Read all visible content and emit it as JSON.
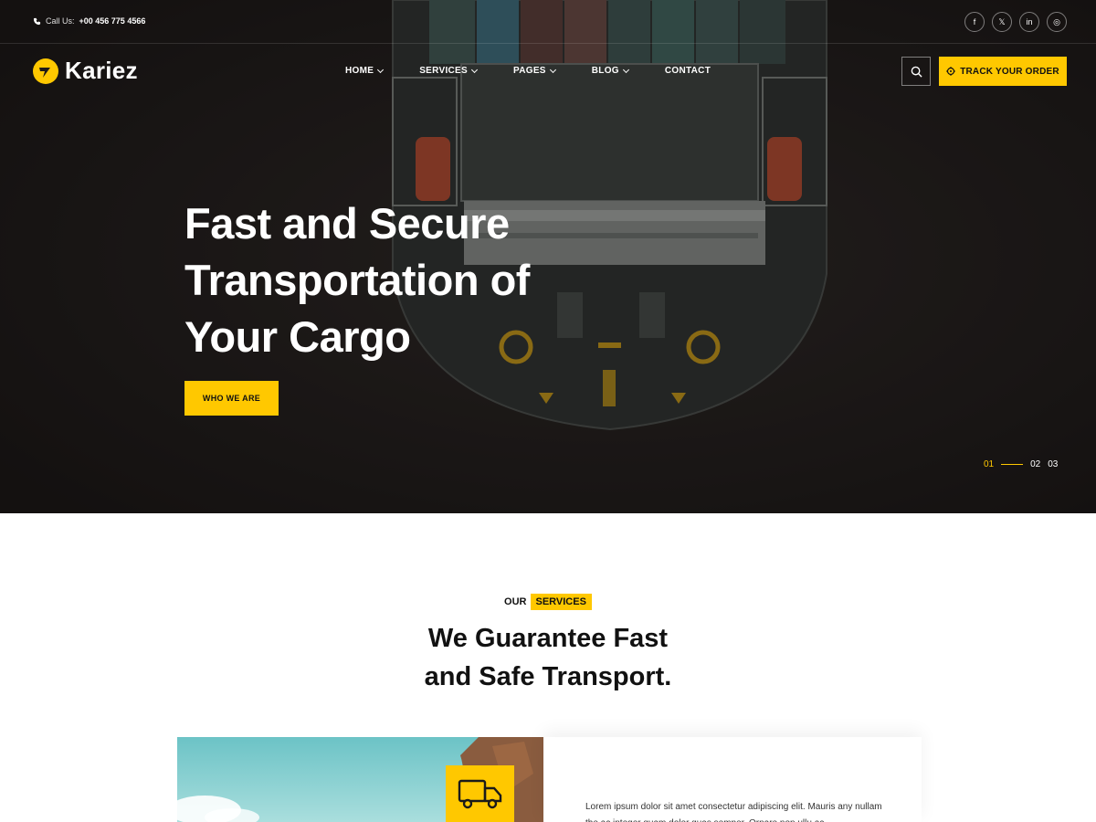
{
  "topbar": {
    "phone_label": "Call Us:",
    "phone_number": "+00 456 775 4566",
    "socials": [
      {
        "icon": "facebook-icon",
        "glyph": "f"
      },
      {
        "icon": "x-icon",
        "glyph": "𝕏"
      },
      {
        "icon": "linkedin-icon",
        "glyph": "in"
      },
      {
        "icon": "instagram-icon",
        "glyph": "◎"
      }
    ]
  },
  "brand": {
    "name": "Kariez",
    "accent": "#ffc800"
  },
  "nav": {
    "items": [
      {
        "label": "HOME",
        "dropdown": true
      },
      {
        "label": "SERVICES",
        "dropdown": true
      },
      {
        "label": "PAGES",
        "dropdown": true
      },
      {
        "label": "BLOG",
        "dropdown": true
      },
      {
        "label": "CONTACT",
        "dropdown": false
      }
    ],
    "track_label": "TRACK YOUR ORDER"
  },
  "hero": {
    "title_lines": [
      "Fast and Secure",
      "Transportation of",
      "Your Cargo"
    ],
    "cta_label": "WHO WE ARE",
    "slides": [
      "01",
      "02",
      "03"
    ],
    "active_slide": "01"
  },
  "services": {
    "tag_prefix": "OUR",
    "tag_highlight": "SERVICES",
    "title_lines": [
      "We Guarantee Fast",
      "and Safe Transport."
    ],
    "card_text": "Lorem ipsum dolor sit amet consectetur adipiscing elit. Mauris any nullam the ac integer quam dolor quas semper. Ornare non ullu ac"
  }
}
